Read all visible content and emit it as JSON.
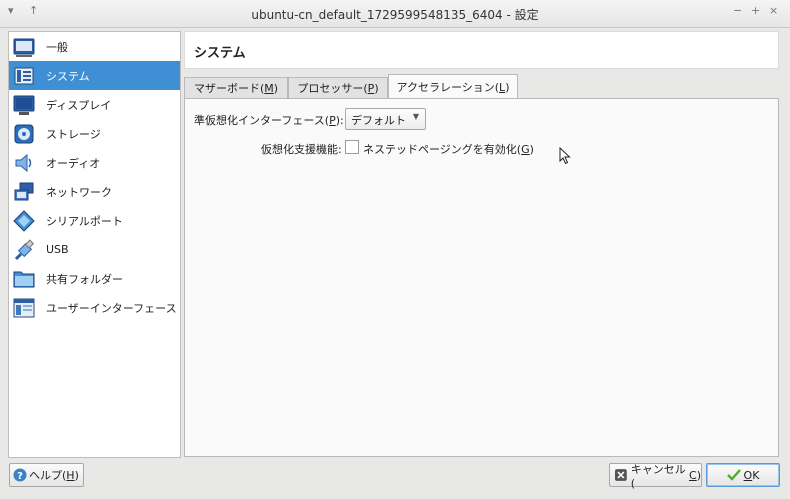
{
  "window": {
    "title": "ubuntu-cn_default_1729599548135_6404 - 設定",
    "left_buttons": [
      "▾",
      "↑"
    ],
    "right_buttons": [
      "−",
      "+",
      "×"
    ]
  },
  "sidebar": {
    "items": [
      {
        "label": "一般",
        "icon": "general-icon",
        "selected": false
      },
      {
        "label": "システム",
        "icon": "system-icon",
        "selected": true
      },
      {
        "label": "ディスプレイ",
        "icon": "display-icon",
        "selected": false
      },
      {
        "label": "ストレージ",
        "icon": "storage-icon",
        "selected": false
      },
      {
        "label": "オーディオ",
        "icon": "audio-icon",
        "selected": false
      },
      {
        "label": "ネットワーク",
        "icon": "network-icon",
        "selected": false
      },
      {
        "label": "シリアルポート",
        "icon": "serial-port-icon",
        "selected": false
      },
      {
        "label": "USB",
        "icon": "usb-icon",
        "selected": false
      },
      {
        "label": "共有フォルダー",
        "icon": "shared-folder-icon",
        "selected": false
      },
      {
        "label": "ユーザーインターフェース",
        "icon": "user-interface-icon",
        "selected": false
      }
    ]
  },
  "header": {
    "title": "システム"
  },
  "tabs": [
    {
      "label": "マザーボード(",
      "mnemonic": "M",
      "suffix": ")",
      "active": false
    },
    {
      "label": "プロセッサー(",
      "mnemonic": "P",
      "suffix": ")",
      "active": false
    },
    {
      "label": "アクセラレーション(",
      "mnemonic": "L",
      "suffix": ")",
      "active": true
    }
  ],
  "acceleration": {
    "paravirt_label": "準仮想化インターフェース(",
    "paravirt_mnemonic": "P",
    "paravirt_suffix": "):",
    "paravirt_value": "デフォルト",
    "hwvirt_label": "仮想化支援機能:",
    "nested_paging_label": "ネステッドページングを有効化(",
    "nested_paging_mnemonic": "G",
    "nested_paging_suffix": ")",
    "nested_paging_checked": false
  },
  "footer": {
    "help_label": "ヘルプ(",
    "help_mnemonic": "H",
    "help_suffix": ")",
    "cancel_label": "キャンセル(",
    "cancel_mnemonic": "C",
    "cancel_suffix": ")",
    "ok_mnemonic": "O",
    "ok_rest": "K"
  },
  "colors": {
    "selection": "#3e8fd4",
    "ok_border": "#5b9ad6",
    "ok_check": "#4caf2a",
    "cancel_icon": "#555555",
    "help_icon": "#3b82c4"
  }
}
